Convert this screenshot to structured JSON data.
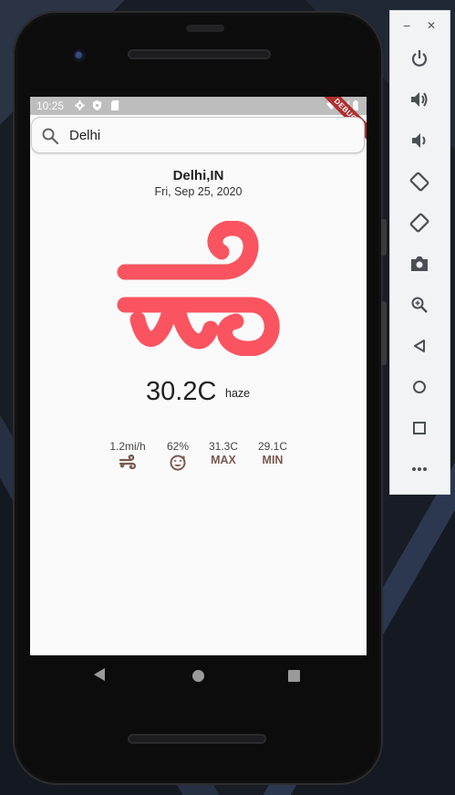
{
  "status_bar": {
    "time": "10:25",
    "debug_label": "DEBUG"
  },
  "search": {
    "value": "Delhi",
    "placeholder": ""
  },
  "location": {
    "city": "Delhi,IN",
    "date": "Fri, Sep 25, 2020"
  },
  "weather": {
    "temperature": "30.2C",
    "condition": "haze",
    "main_icon": "wind-icon",
    "accent_color": "#fa5460",
    "stat_color": "#7a5a50"
  },
  "stats": [
    {
      "value": "1.2mi/h",
      "icon": "wind-icon"
    },
    {
      "value": "62%",
      "icon": "humidity-face-icon"
    },
    {
      "value": "31.3C",
      "label": "MAX"
    },
    {
      "value": "29.1C",
      "label": "MIN"
    }
  ],
  "emulator_panel": {
    "minimize": "−",
    "close": "✕",
    "buttons": [
      "power-icon",
      "volume-up-icon",
      "volume-down-icon",
      "rotate-left-icon",
      "rotate-right-icon",
      "camera-icon",
      "zoom-icon",
      "back-icon",
      "home-icon",
      "overview-icon",
      "more-icon"
    ]
  }
}
